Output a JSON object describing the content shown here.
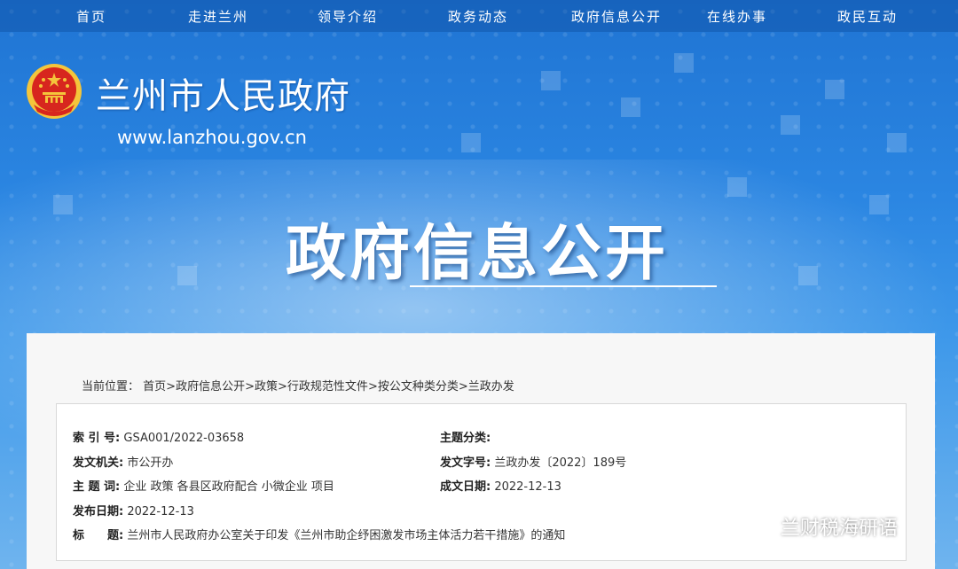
{
  "nav": {
    "items": [
      "首页",
      "走进兰州",
      "领导介绍",
      "政务动态",
      "政府信息公开",
      "在线办事",
      "政民互动"
    ]
  },
  "header": {
    "site_title": "兰州市人民政府",
    "site_url": "www.lanzhou.gov.cn",
    "section_title": "政府信息公开"
  },
  "breadcrumb": {
    "prefix": "当前位置：",
    "items": [
      "首页",
      "政府信息公开",
      "政策",
      "行政规范性文件",
      "按公文种类分类",
      "兰政办发"
    ],
    "separator": ">"
  },
  "info": {
    "index_label": "索 引 号:",
    "index_value": "GSA001/2022-03658",
    "topic_label": "主题分类:",
    "topic_value": "",
    "issuer_label": "发文机关:",
    "issuer_value": "市公开办",
    "doc_no_label": "发文字号:",
    "doc_no_value": "兰政办发〔2022〕189号",
    "keywords_label": "主 题 词:",
    "keywords_value": "企业 政策 各县区政府配合 小微企业 项目",
    "created_label": "成文日期:",
    "created_value": "2022-12-13",
    "published_label": "发布日期:",
    "published_value": "2022-12-13",
    "title_label": "标　　题:",
    "title_value": "兰州市人民政府办公室关于印发《兰州市助企纾困激发市场主体活力若干措施》的通知"
  },
  "watermark": {
    "text": "兰财税海研语",
    "icon": "wechat-icon"
  },
  "colors": {
    "banner_top": "#1f74d3",
    "banner_bottom": "#6fb4ee",
    "emblem_red": "#d7261e",
    "emblem_gold": "#f4c53b"
  }
}
